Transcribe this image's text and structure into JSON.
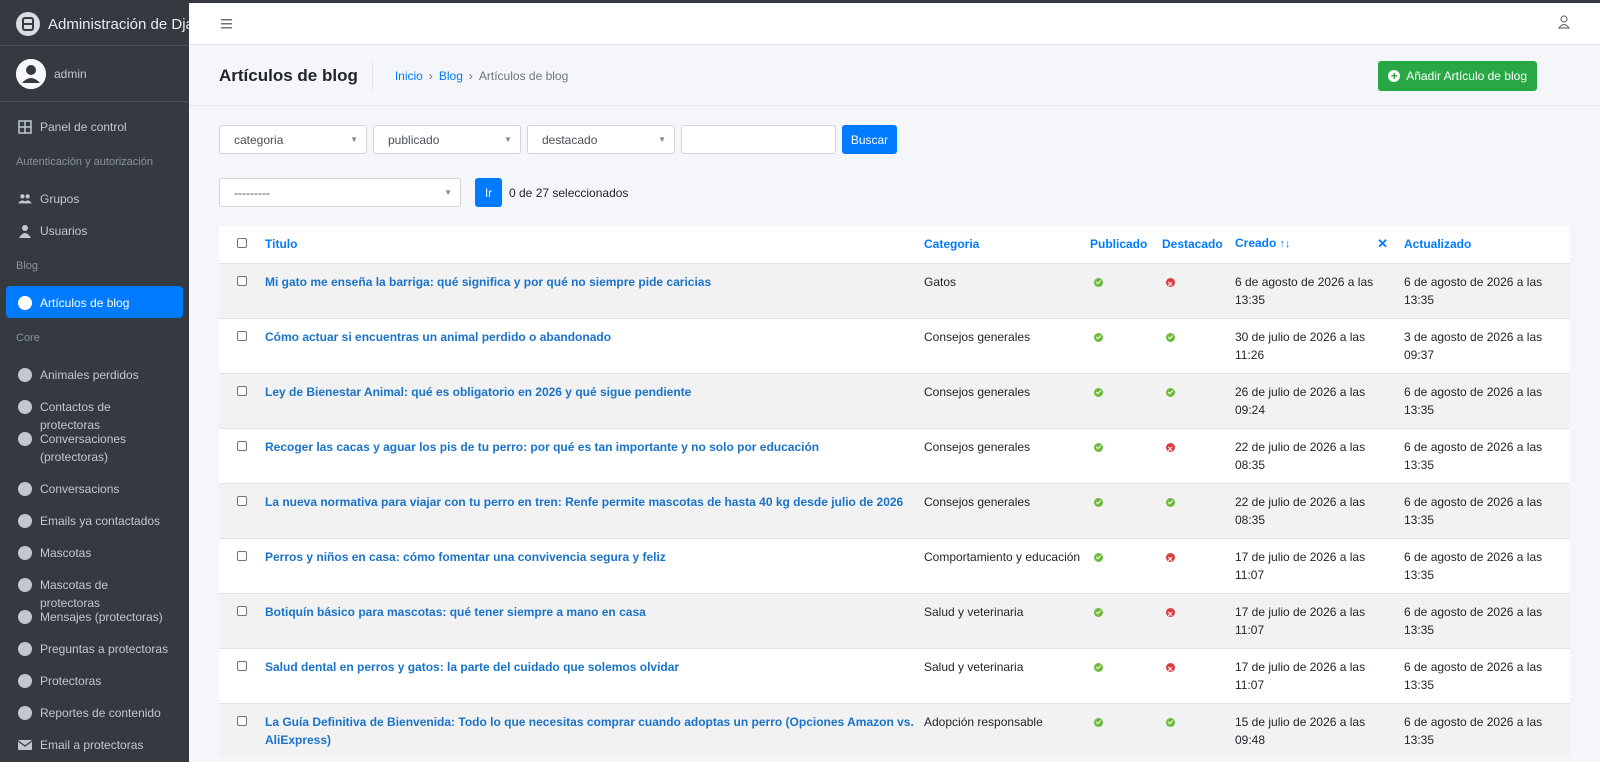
{
  "brand": {
    "title": "Administración de Django"
  },
  "user": {
    "name": "admin"
  },
  "sidebar": {
    "dashboard": "Panel de control",
    "groups": [
      {
        "header": "Autenticación y autorización",
        "items": [
          {
            "label": "Grupos",
            "icon": "users-icon"
          },
          {
            "label": "Usuarios",
            "icon": "user-icon"
          }
        ]
      },
      {
        "header": "Blog",
        "items": [
          {
            "label": "Artículos de blog",
            "icon": "circle-icon",
            "active": true
          }
        ]
      },
      {
        "header": "Core",
        "items": [
          {
            "label": "Animales perdidos"
          },
          {
            "label": "Contactos de protectoras"
          },
          {
            "label": "Conversaciones (protectoras)"
          },
          {
            "label": "Conversacions"
          },
          {
            "label": "Emails ya contactados"
          },
          {
            "label": "Mascotas"
          },
          {
            "label": "Mascotas de protectoras"
          },
          {
            "label": "Mensajes (protectoras)"
          },
          {
            "label": "Preguntas a protectoras"
          },
          {
            "label": "Protectoras"
          },
          {
            "label": "Reportes de contenido"
          },
          {
            "label": "Email a protectoras",
            "icon": "envelope-icon"
          }
        ]
      }
    ]
  },
  "header": {
    "page_title": "Artículos de blog",
    "breadcrumb": [
      "Inicio",
      "Blog",
      "Artículos de blog"
    ],
    "add_button": "Añadir Artículo de blog"
  },
  "filters": {
    "categoria": "categoria",
    "publicado": "publicado",
    "destacado": "destacado",
    "search_value": "",
    "search_button": "Buscar"
  },
  "actions": {
    "selected_action": "---------",
    "go_button": "Ir",
    "count_text": "0 de 27 seleccionados"
  },
  "table": {
    "columns": [
      "Titulo",
      "Categoria",
      "Publicado",
      "Destacado",
      "Creado",
      "Actualizado"
    ],
    "sort_icon": "sort-asc-icon",
    "rows": [
      {
        "titulo": "Mi gato me enseña la barriga: qué significa y por qué no siempre pide caricias",
        "categoria": "Gatos",
        "publicado": true,
        "destacado": false,
        "creado": "6 de agosto de 2026 a las 13:35",
        "actualizado": "6 de agosto de 2026 a las 13:35"
      },
      {
        "titulo": "Cómo actuar si encuentras un animal perdido o abandonado",
        "categoria": "Consejos generales",
        "publicado": true,
        "destacado": true,
        "creado": "30 de julio de 2026 a las 11:26",
        "actualizado": "3 de agosto de 2026 a las 09:37"
      },
      {
        "titulo": "Ley de Bienestar Animal: qué es obligatorio en 2026 y qué sigue pendiente",
        "categoria": "Consejos generales",
        "publicado": true,
        "destacado": true,
        "creado": "26 de julio de 2026 a las 09:24",
        "actualizado": "6 de agosto de 2026 a las 13:35"
      },
      {
        "titulo": "Recoger las cacas y aguar los pis de tu perro: por qué es tan importante y no solo por educación",
        "categoria": "Consejos generales",
        "publicado": true,
        "destacado": false,
        "creado": "22 de julio de 2026 a las 08:35",
        "actualizado": "6 de agosto de 2026 a las 13:35"
      },
      {
        "titulo": "La nueva normativa para viajar con tu perro en tren: Renfe permite mascotas de hasta 40 kg desde julio de 2026",
        "categoria": "Consejos generales",
        "publicado": true,
        "destacado": true,
        "creado": "22 de julio de 2026 a las 08:35",
        "actualizado": "6 de agosto de 2026 a las 13:35"
      },
      {
        "titulo": "Perros y niños en casa: cómo fomentar una convivencia segura y feliz",
        "categoria": "Comportamiento y educación",
        "publicado": true,
        "destacado": false,
        "creado": "17 de julio de 2026 a las 11:07",
        "actualizado": "6 de agosto de 2026 a las 13:35"
      },
      {
        "titulo": "Botiquín básico para mascotas: qué tener siempre a mano en casa",
        "categoria": "Salud y veterinaria",
        "publicado": true,
        "destacado": false,
        "creado": "17 de julio de 2026 a las 11:07",
        "actualizado": "6 de agosto de 2026 a las 13:35"
      },
      {
        "titulo": "Salud dental en perros y gatos: la parte del cuidado que solemos olvidar",
        "categoria": "Salud y veterinaria",
        "publicado": true,
        "destacado": false,
        "creado": "17 de julio de 2026 a las 11:07",
        "actualizado": "6 de agosto de 2026 a las 13:35"
      },
      {
        "titulo": "La Guía Definitiva de Bienvenida: Todo lo que necesitas comprar cuando adoptas un perro (Opciones Amazon vs. AliExpress)",
        "categoria": "Adopción responsable",
        "publicado": true,
        "destacado": true,
        "creado": "15 de julio de 2026 a las 09:48",
        "actualizado": "6 de agosto de 2026 a las 13:35"
      }
    ]
  },
  "colors": {
    "accent": "#007bff",
    "success": "#28a745",
    "sidebar": "#343a40"
  }
}
